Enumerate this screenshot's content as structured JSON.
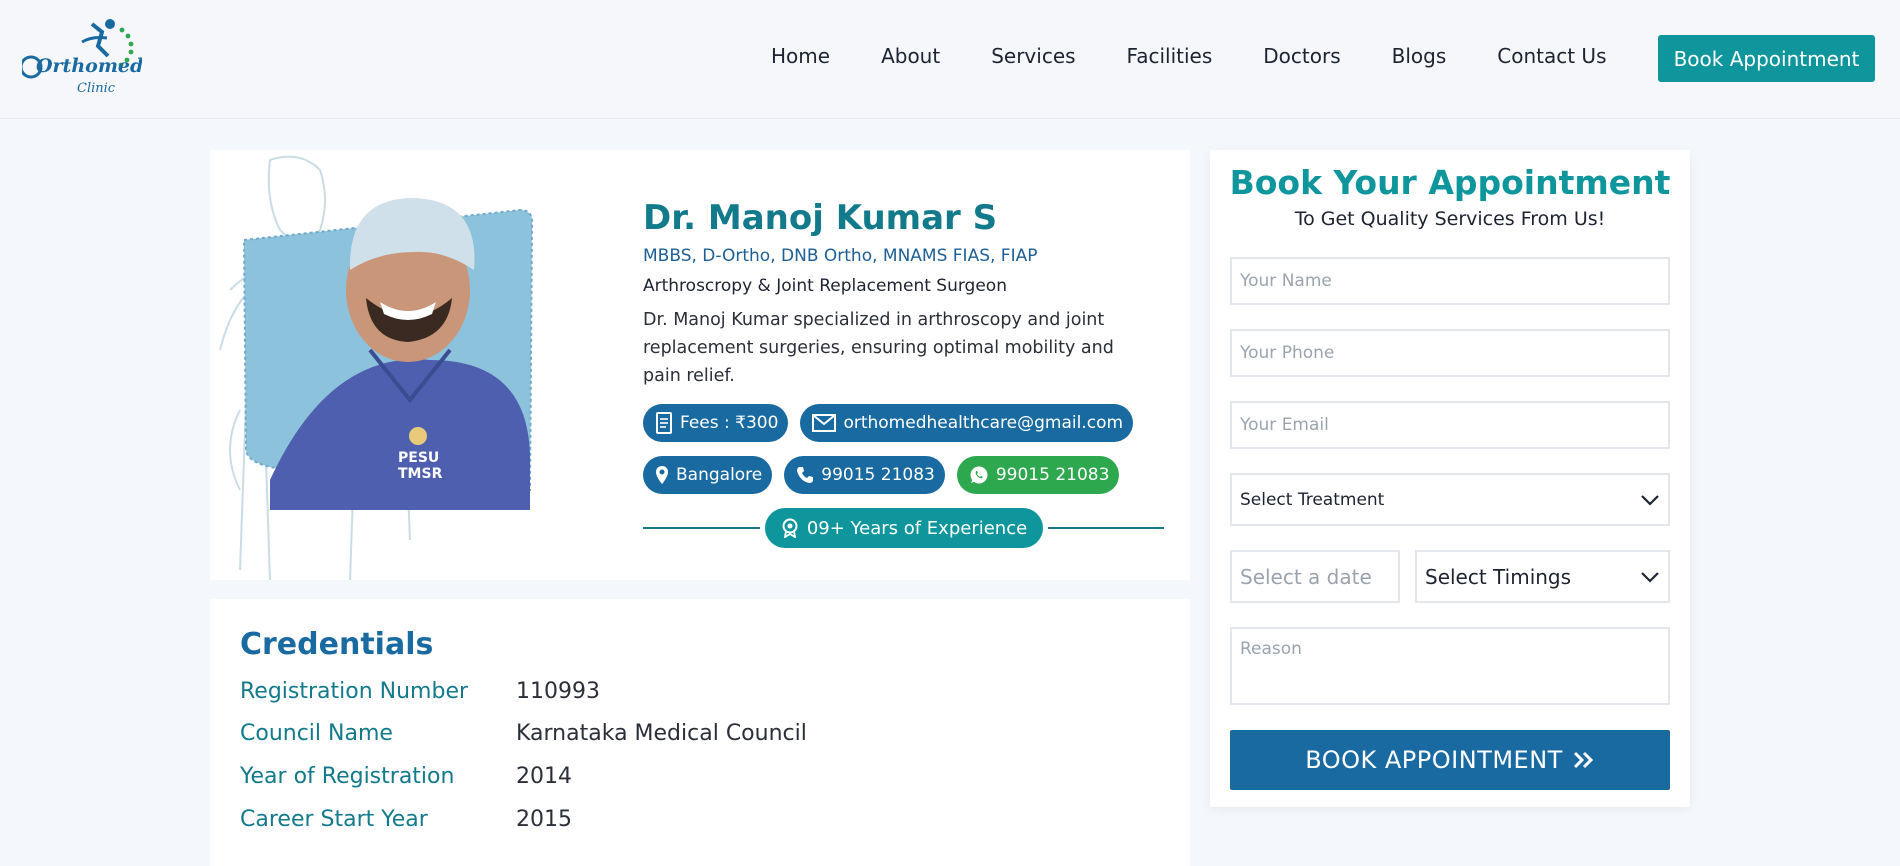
{
  "nav": {
    "items": [
      "Home",
      "About",
      "Services",
      "Facilities",
      "Doctors",
      "Blogs",
      "Contact Us"
    ],
    "book_label": "Book Appointment"
  },
  "brand": {
    "logo_text": "Orthomed",
    "logo_sub": "Clinic"
  },
  "doctor": {
    "name": "Dr. Manoj Kumar S",
    "qualifications": "MBBS, D-Ortho, DNB Ortho, MNAMS FIAS, FIAP",
    "specialty": "Arthroscropy & Joint Replacement Surgeon",
    "description": "Dr. Manoj Kumar specialized in arthroscopy and joint replacement surgeries, ensuring optimal mobility and pain relief.",
    "fees": "Fees : ₹300",
    "email": "orthomedhealthcare@gmail.com",
    "location": "Bangalore",
    "phone": "99015 21083",
    "whatsapp": "99015 21083",
    "experience": "09+ Years of Experience",
    "scrub_text_1": "PESU",
    "scrub_text_2": "TMSR"
  },
  "credentials": {
    "title": "Credentials",
    "rows": [
      {
        "label": "Registration Number",
        "value": "110993"
      },
      {
        "label": "Council Name",
        "value": "Karnataka Medical Council"
      },
      {
        "label": "Year of Registration",
        "value": "2014"
      },
      {
        "label": "Career Start Year",
        "value": "2015"
      }
    ]
  },
  "form": {
    "title": "Book Your Appointment",
    "subtitle": "To Get Quality Services From Us!",
    "name_placeholder": "Your Name",
    "phone_placeholder": "Your Phone",
    "email_placeholder": "Your Email",
    "treatment_selected": "Select Treatment",
    "date_placeholder": "Select a date",
    "timings_selected": "Select Timings",
    "reason_placeholder": "Reason",
    "submit_label": "BOOK APPOINTMENT"
  },
  "colors": {
    "teal": "#0f969c",
    "blue": "#1a6aa2",
    "green": "#2ea84f"
  }
}
